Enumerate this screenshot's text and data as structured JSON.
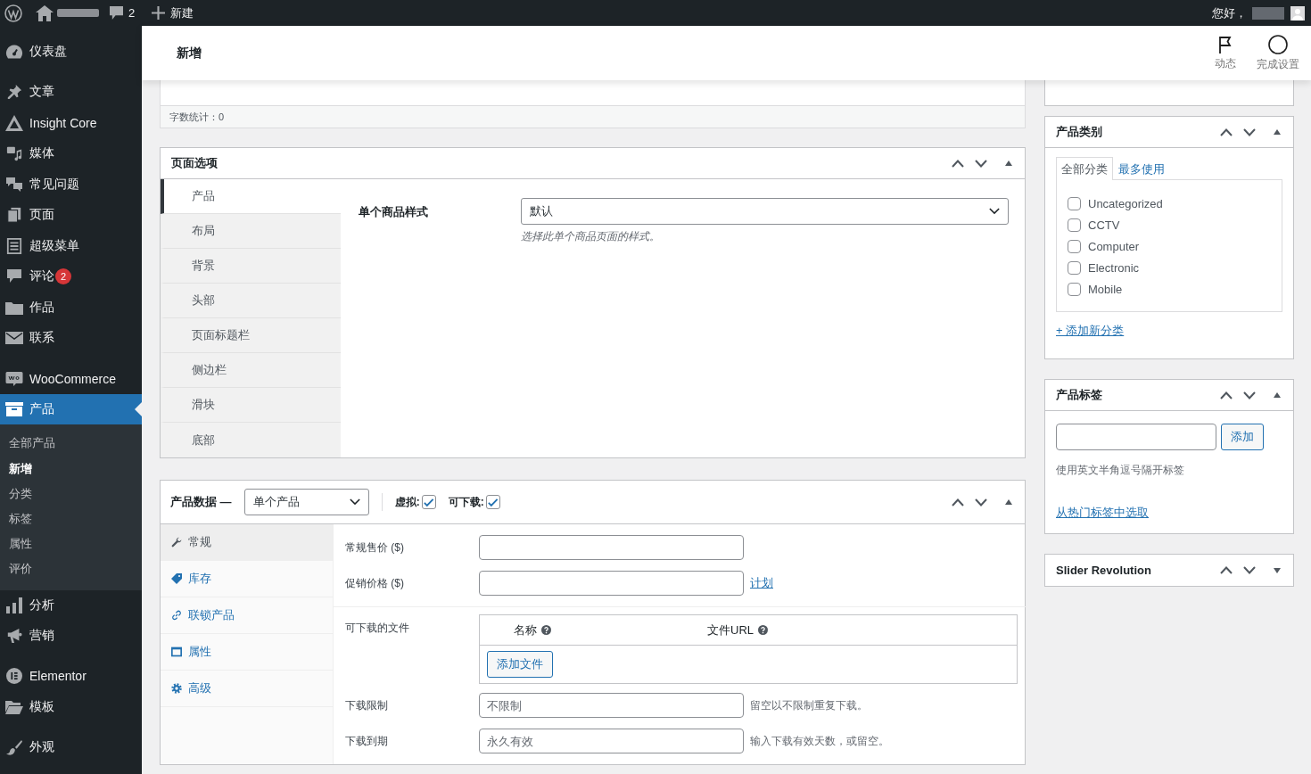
{
  "admin_bar": {
    "comment_count": "2",
    "new_label": "新建",
    "greeting": "您好，"
  },
  "sidebar": {
    "groups": [
      {
        "items": [
          {
            "label": "仪表盘",
            "selected": false
          }
        ]
      },
      {
        "items": [
          {
            "label": "文章",
            "selected": false
          },
          {
            "label": "Insight Core",
            "selected": false
          },
          {
            "label": "媒体",
            "selected": false
          },
          {
            "label": "常见问题",
            "selected": false
          },
          {
            "label": "页面",
            "selected": false
          },
          {
            "label": "超级菜单",
            "selected": false
          },
          {
            "label": "评论",
            "badge": "2",
            "selected": false
          },
          {
            "label": "作品",
            "selected": false
          },
          {
            "label": "联系",
            "selected": false
          }
        ]
      },
      {
        "items": [
          {
            "label": "WooCommerce",
            "selected": false
          },
          {
            "label": "产品",
            "selected": true,
            "children": [
              {
                "label": "全部产品",
                "selected": false
              },
              {
                "label": "新增",
                "selected": true
              },
              {
                "label": "分类",
                "selected": false
              },
              {
                "label": "标签",
                "selected": false
              },
              {
                "label": "属性",
                "selected": false
              },
              {
                "label": "评价",
                "selected": false
              }
            ]
          },
          {
            "label": "分析",
            "selected": false
          },
          {
            "label": "营销",
            "selected": false
          }
        ]
      },
      {
        "items": [
          {
            "label": "Elementor",
            "selected": false
          },
          {
            "label": "模板",
            "selected": false
          }
        ]
      },
      {
        "items": [
          {
            "label": "外观",
            "selected": false
          }
        ]
      }
    ]
  },
  "header": {
    "title": "新增",
    "actions": [
      {
        "label": "动态"
      },
      {
        "label": "完成设置"
      }
    ]
  },
  "editor": {
    "word_count": "字数统计：0"
  },
  "page_options": {
    "title": "页面选项",
    "expanded": true,
    "tabs": [
      {
        "label": "产品",
        "selected": true
      },
      {
        "label": "布局",
        "selected": false
      },
      {
        "label": "背景",
        "selected": false
      },
      {
        "label": "头部",
        "selected": false
      },
      {
        "label": "页面标题栏",
        "selected": false
      },
      {
        "label": "侧边栏",
        "selected": false
      },
      {
        "label": "滑块",
        "selected": false
      },
      {
        "label": "底部",
        "selected": false
      }
    ],
    "fields": [
      {
        "label": "单个商品样式",
        "value": "默认",
        "description": "选择此单个商品页面的样式。"
      }
    ]
  },
  "product_data": {
    "title": "产品数据 —",
    "product_type": "单个产品",
    "options": [
      {
        "label": "虚拟:",
        "checked": true
      },
      {
        "label": "可下载:",
        "checked": true
      }
    ],
    "expanded": true,
    "tabs": [
      {
        "label": "常规",
        "selected": true
      },
      {
        "label": "库存",
        "selected": false
      },
      {
        "label": "联锁产品",
        "selected": false
      },
      {
        "label": "属性",
        "selected": false
      },
      {
        "label": "高级",
        "selected": false
      }
    ],
    "price_fields": [
      {
        "label": "常规售价 ($)"
      },
      {
        "label": "促销价格 ($)",
        "link": "计划"
      }
    ],
    "downloadable_files": {
      "label": "可下载的文件",
      "columns": [
        {
          "label": "名称"
        },
        {
          "label": "文件URL"
        }
      ],
      "add_button": "添加文件"
    },
    "limit_fields": [
      {
        "label": "下载限制",
        "placeholder": "不限制",
        "description": "留空以不限制重复下载。"
      },
      {
        "label": "下载到期",
        "placeholder": "永久有效",
        "description": "输入下载有效天数，或留空。"
      }
    ]
  },
  "categories": {
    "title": "产品类别",
    "expanded": true,
    "tabs": [
      {
        "label": "全部分类",
        "selected": true
      },
      {
        "label": "最多使用",
        "selected": false
      }
    ],
    "items": [
      {
        "label": "Uncategorized",
        "checked": false
      },
      {
        "label": "CCTV",
        "checked": false
      },
      {
        "label": "Computer",
        "checked": false
      },
      {
        "label": "Electronic",
        "checked": false
      },
      {
        "label": "Mobile",
        "checked": false
      }
    ],
    "add_link": "+ 添加新分类"
  },
  "tags": {
    "title": "产品标签",
    "expanded": true,
    "add_button": "添加",
    "hint": "使用英文半角逗号隔开标签",
    "choose_link": "从热门标签中选取"
  },
  "slider_revolution": {
    "title": "Slider Revolution",
    "expanded": false
  }
}
